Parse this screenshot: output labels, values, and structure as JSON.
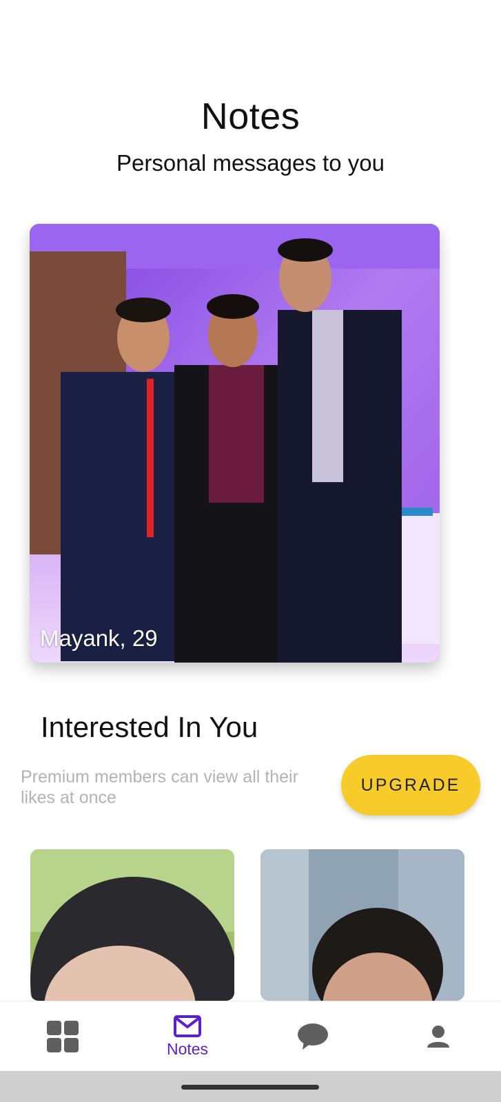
{
  "header": {
    "title": "Notes",
    "subtitle": "Personal messages to you"
  },
  "note_card": {
    "name_age": "Mayank, 29"
  },
  "interested": {
    "title": "Interested In You",
    "premium_text": "Premium members can view all their likes at once",
    "upgrade_label": "UPGRADE"
  },
  "bottom_nav": {
    "items": [
      {
        "icon": "grid-icon",
        "label": ""
      },
      {
        "icon": "mail-icon",
        "label": "Notes",
        "active": true
      },
      {
        "icon": "chat-bubble-icon",
        "label": ""
      },
      {
        "icon": "person-icon",
        "label": ""
      }
    ]
  },
  "colors": {
    "accent": "#5b1fd0",
    "upgrade": "#f7cb2a",
    "inactive_icon": "#5f5f5f"
  }
}
